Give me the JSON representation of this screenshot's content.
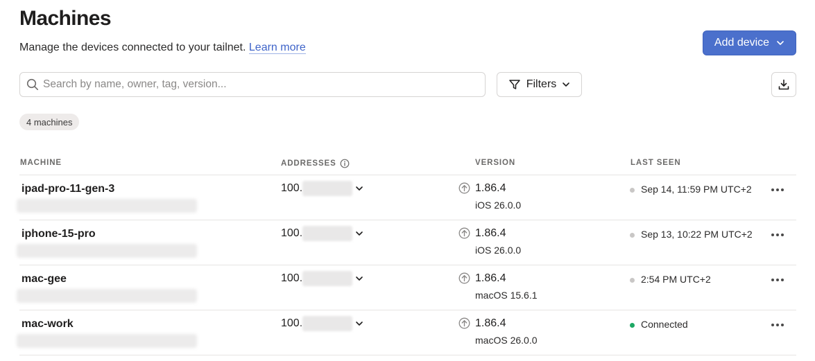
{
  "header": {
    "title": "Machines",
    "subtitle": "Manage the devices connected to your tailnet.",
    "learn_more": "Learn more",
    "add_device_label": "Add device"
  },
  "toolbar": {
    "search_placeholder": "Search by name, owner, tag, version...",
    "search_value": "",
    "filters_label": "Filters"
  },
  "count_label": "4 machines",
  "columns": {
    "machine": "MACHINE",
    "addresses": "ADDRESSES",
    "version": "VERSION",
    "last_seen": "LAST SEEN"
  },
  "machines": [
    {
      "name": "ipad-pro-11-gen-3",
      "address_prefix": "100.",
      "version": "1.86.4",
      "os": "iOS 26.0.0",
      "last_seen": "Sep 14, 11:59 PM UTC+2",
      "status": "offline"
    },
    {
      "name": "iphone-15-pro",
      "address_prefix": "100.",
      "version": "1.86.4",
      "os": "iOS 26.0.0",
      "last_seen": "Sep 13, 10:22 PM UTC+2",
      "status": "offline"
    },
    {
      "name": "mac-gee",
      "address_prefix": "100.",
      "version": "1.86.4",
      "os": "macOS 15.6.1",
      "last_seen": "2:54 PM UTC+2",
      "status": "offline"
    },
    {
      "name": "mac-work",
      "address_prefix": "100.",
      "version": "1.86.4",
      "os": "macOS 26.0.0",
      "last_seen": "Connected",
      "status": "online"
    }
  ],
  "colors": {
    "accent": "#4b70cc",
    "link": "#3f64c9",
    "online": "#1da864",
    "offline": "#c9c7c6"
  },
  "icons": {
    "search": "search-icon",
    "filter": "filter-icon",
    "download": "download-icon",
    "info": "info-icon",
    "update": "update-available-icon",
    "more": "more-horizontal-icon"
  }
}
